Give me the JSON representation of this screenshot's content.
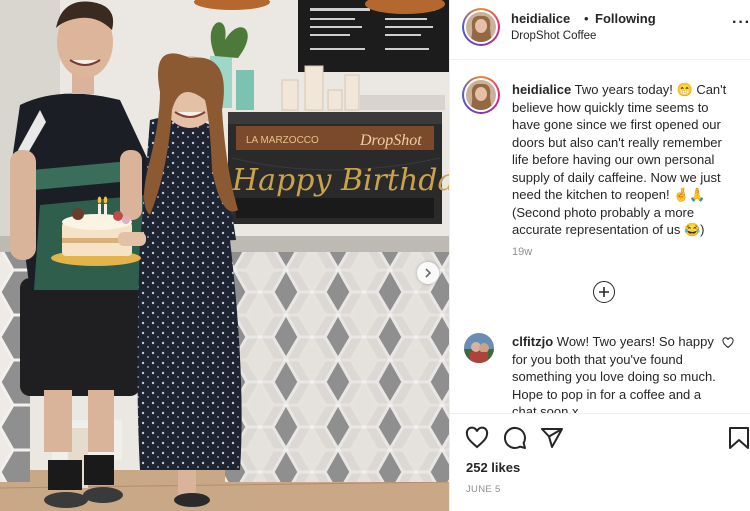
{
  "post": {
    "username": "heidialice",
    "dot": "•",
    "follow_label": "Following",
    "location": "DropShot Coffee",
    "more_label": "···"
  },
  "photo": {
    "sign_brand": "DropShot",
    "sign_machine": "LA MARZOCCO",
    "banner_text": "Happy Birthday"
  },
  "caption": {
    "username": "heidialice",
    "text": "Two years today! 😁 Can't believe how quickly time seems to have gone since we first opened our doors but also can't really remember life before having our own personal supply of daily caffeine. Now we just need the kitchen to reopen! 🤞🙏 (Second photo probably a more accurate representation of us 😂)",
    "time": "19w"
  },
  "comment": {
    "username": "clfitzjo",
    "text": "Wow! Two years! So happy for you both that you've found something you love doing so much. Hope to pop in for a coffee and a chat soon x"
  },
  "footer": {
    "likes": "252 likes",
    "date": "JUNE 5"
  },
  "icons": {
    "like": "heart-icon",
    "comment": "comment-icon",
    "share": "share-icon",
    "save": "bookmark-icon",
    "more": "more-options-icon",
    "add_comment": "plus-circle-icon",
    "carousel_next": "chevron-right-icon"
  },
  "colors": {
    "text": "#262626",
    "secondary": "#8e8e8e",
    "divider": "#efefef",
    "banner_gold": "#c9a24a"
  }
}
